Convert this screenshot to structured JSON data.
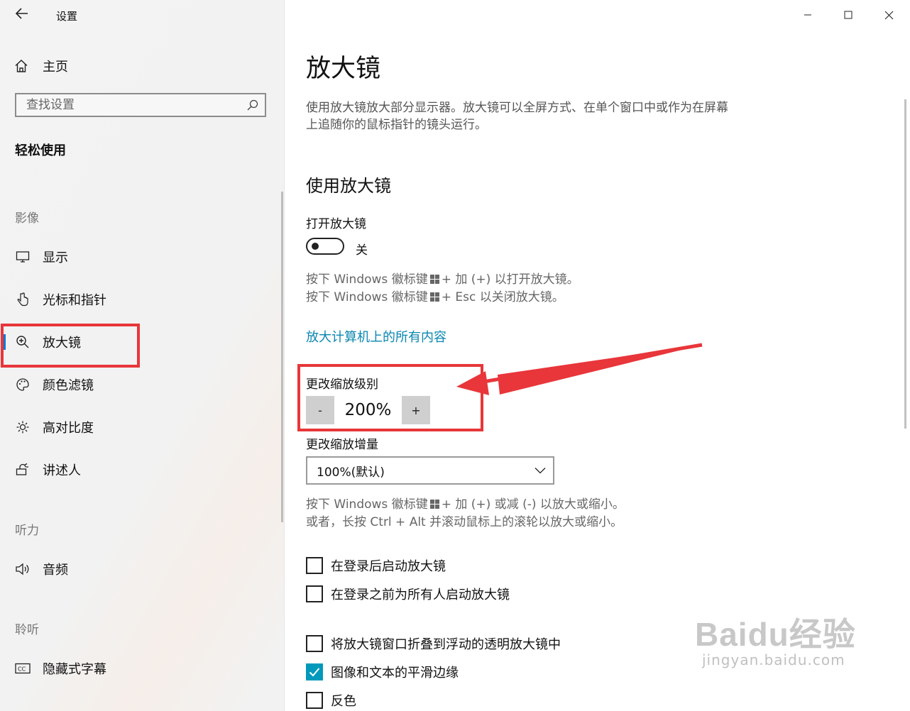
{
  "app": {
    "title": "设置"
  },
  "sidebar": {
    "home_label": "主页",
    "search_placeholder": "查找设置",
    "category": "轻松使用",
    "groups": {
      "vision": "影像",
      "hearing": "听力",
      "hearing2": "聆听"
    },
    "items": [
      {
        "label": "显示",
        "icon": "monitor-icon"
      },
      {
        "label": "光标和指针",
        "icon": "pointer-icon"
      },
      {
        "label": "放大镜",
        "icon": "magnifier-icon",
        "active": true
      },
      {
        "label": "颜色滤镜",
        "icon": "palette-icon"
      },
      {
        "label": "高对比度",
        "icon": "brightness-icon"
      },
      {
        "label": "讲述人",
        "icon": "narrator-icon"
      },
      {
        "label": "音频",
        "icon": "speaker-icon"
      },
      {
        "label": "隐藏式字幕",
        "icon": "captions-icon"
      }
    ]
  },
  "main": {
    "title": "放大镜",
    "description": "使用放大镜放大部分显示器。放大镜可以全屏方式、在单个窗口中或作为在屏幕上追随你的鼠标指针的镜头运行。",
    "section_title": "使用放大镜",
    "toggle": {
      "label": "打开放大镜",
      "state": "关"
    },
    "toggle_hint": {
      "line1_a": "按下 Windows 徽标键",
      "line1_b": "+ 加 (+) 以打开放大镜。",
      "line2_a": "按下 Windows 徽标键",
      "line2_b": "+ Esc 以关闭放大镜。"
    },
    "link": "放大计算机上的所有内容",
    "zoom": {
      "label": "更改缩放级别",
      "minus": "-",
      "value": "200%",
      "plus": "+"
    },
    "increment": {
      "label": "更改缩放增量",
      "value": "100%(默认)"
    },
    "zoom_hint": {
      "line1_a": "按下 Windows 徽标键",
      "line1_b": "+ 加 (+) 或减 (-) 以放大或缩小。",
      "line2": "或者，长按 Ctrl + Alt 并滚动鼠标上的滚轮以放大或缩小。"
    },
    "checkboxes": [
      {
        "label": "在登录后启动放大镜",
        "checked": false
      },
      {
        "label": "在登录之前为所有人启动放大镜",
        "checked": false
      },
      {
        "label": "将放大镜窗口折叠到浮动的透明放大镜中",
        "checked": false
      },
      {
        "label": "图像和文本的平滑边缘",
        "checked": true
      },
      {
        "label": "反色",
        "checked": false
      }
    ]
  },
  "watermark": {
    "main": "Baidu经验",
    "sub": "jingyan.baidu.com"
  },
  "colors": {
    "accent": "#0078d7",
    "link": "#0a87b0",
    "checkbox": "#0099bc",
    "annotation": "#e8363a"
  }
}
